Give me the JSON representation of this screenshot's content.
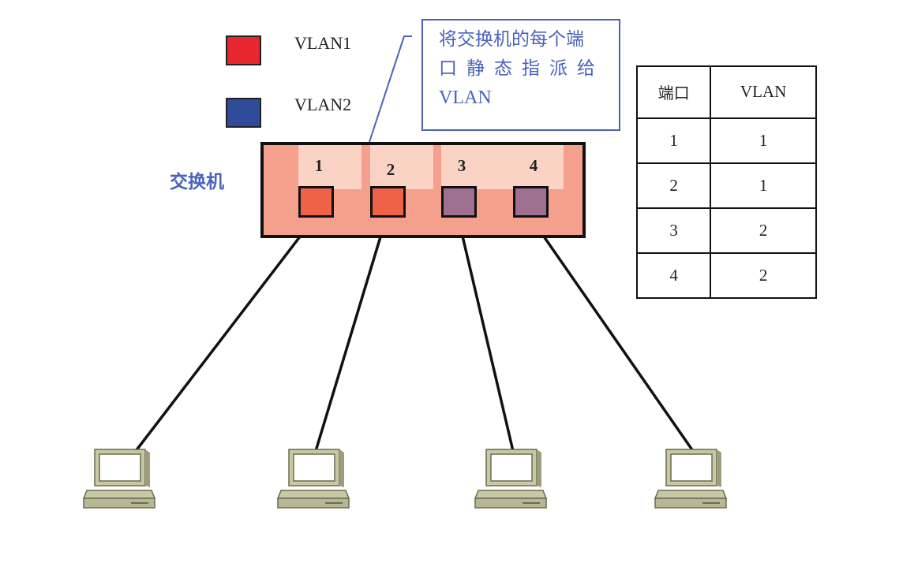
{
  "legend": [
    {
      "label": "VLAN1",
      "color": "#e8262e"
    },
    {
      "label": "VLAN2",
      "color": "#2f4b9a"
    }
  ],
  "callout": {
    "lines": [
      "将交换机的每个端",
      "口静态指派给",
      "VLAN"
    ]
  },
  "switch": {
    "label": "交换机",
    "ports": [
      {
        "number": "1",
        "color": "#ee6347"
      },
      {
        "number": "2",
        "color": "#ee6347"
      },
      {
        "number": "3",
        "color": "#9e7090"
      },
      {
        "number": "4",
        "color": "#9e7090"
      }
    ]
  },
  "table": {
    "headers": [
      "端口",
      "VLAN"
    ],
    "rows": [
      [
        "1",
        "1"
      ],
      [
        "2",
        "1"
      ],
      [
        "3",
        "2"
      ],
      [
        "4",
        "2"
      ]
    ]
  },
  "colors": {
    "callout_blue": "#4a63b8",
    "switch_body": "#f4a08c",
    "computer": "#c8c8a4"
  },
  "computers": [
    "pc-1",
    "pc-2",
    "pc-3",
    "pc-4"
  ]
}
